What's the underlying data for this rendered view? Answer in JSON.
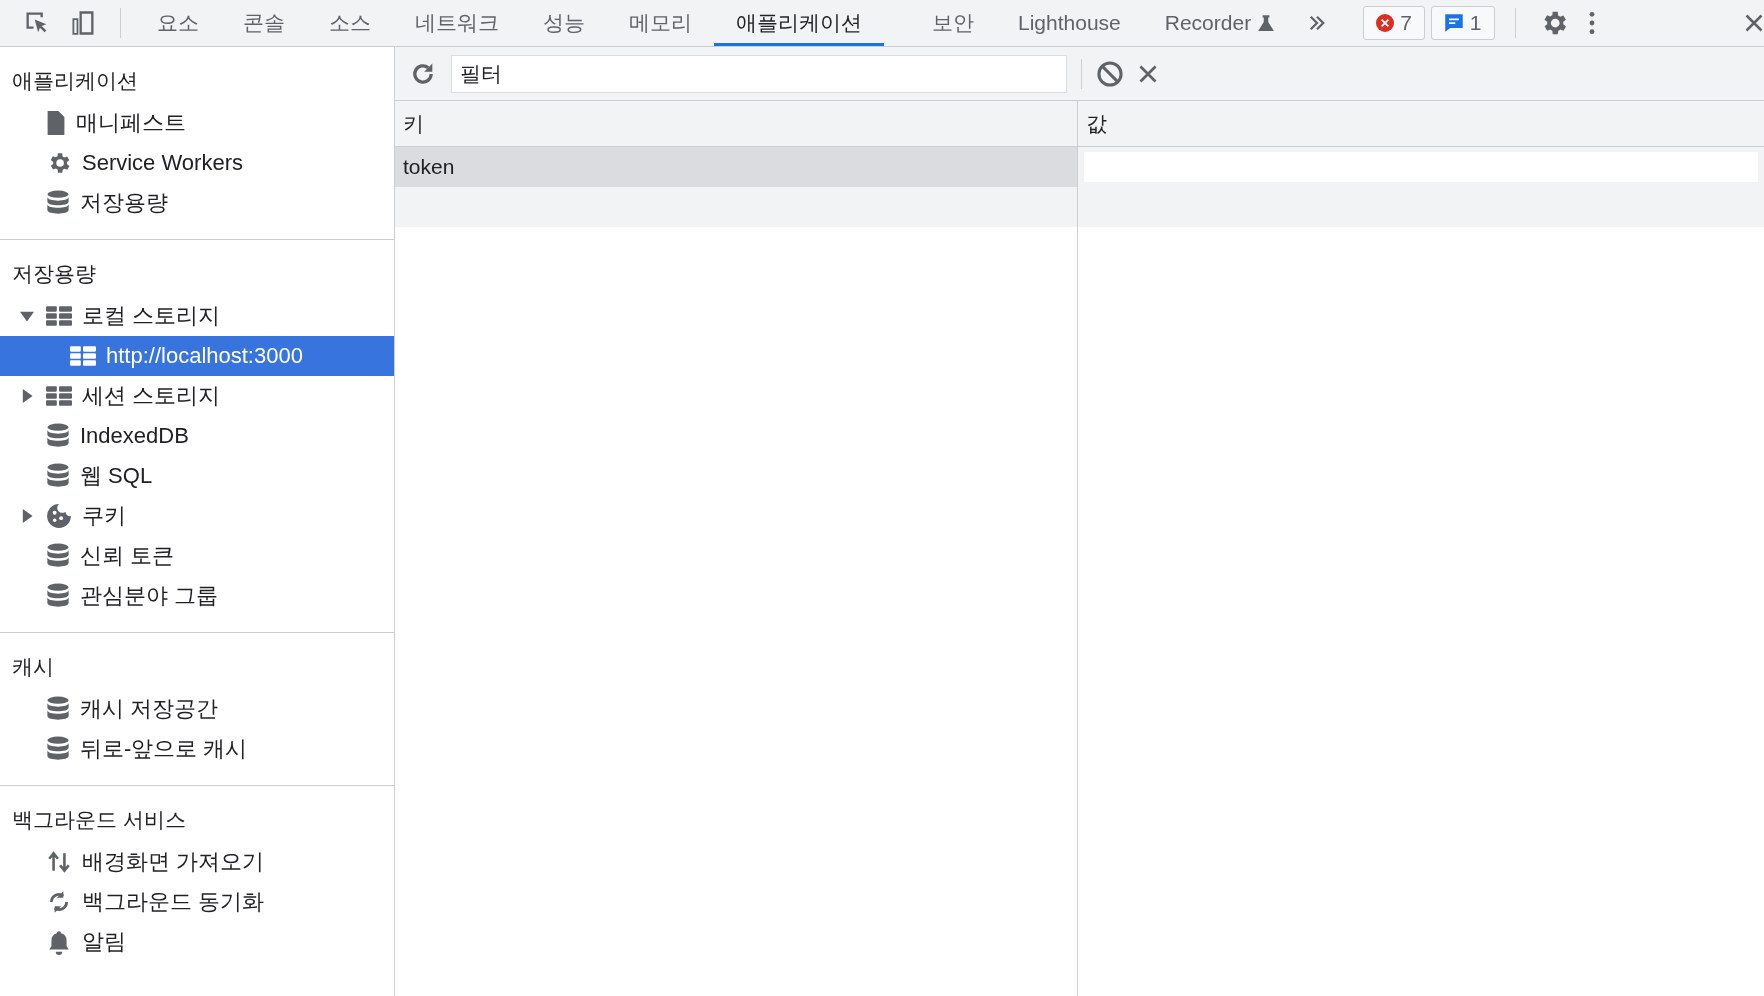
{
  "tabs": [
    {
      "label": "요소",
      "selected": false
    },
    {
      "label": "콘솔",
      "selected": false
    },
    {
      "label": "소스",
      "selected": false
    },
    {
      "label": "네트워크",
      "selected": false
    },
    {
      "label": "성능",
      "selected": false
    },
    {
      "label": "메모리",
      "selected": false
    },
    {
      "label": "애플리케이션",
      "selected": true
    },
    {
      "label": "보안",
      "selected": false
    },
    {
      "label": "Lighthouse",
      "selected": false
    },
    {
      "label": "Recorder",
      "selected": false,
      "kind": "experiment"
    }
  ],
  "badges": [
    {
      "kind": "error",
      "count": "7"
    },
    {
      "kind": "message",
      "count": "1"
    }
  ],
  "sidebar": [
    {
      "title": "애플리케이션",
      "items": [
        {
          "label": "매니페스트",
          "kind": "file",
          "selected": false
        },
        {
          "label": "Service Workers",
          "kind": "gear",
          "selected": false
        },
        {
          "label": "저장용량",
          "kind": "database",
          "selected": false
        }
      ]
    },
    {
      "title": "저장용량",
      "items": [
        {
          "label": "로컬 스토리지",
          "kind": "table",
          "selected": false,
          "expanded": true,
          "children": [
            {
              "label": "http://localhost:3000",
              "kind": "table",
              "selected": true
            }
          ]
        },
        {
          "label": "세션 스토리지",
          "kind": "table",
          "selected": false,
          "expanded": false
        },
        {
          "label": "IndexedDB",
          "kind": "database",
          "selected": false
        },
        {
          "label": "웹 SQL",
          "kind": "database",
          "selected": false
        },
        {
          "label": "쿠키",
          "kind": "cookie",
          "selected": false,
          "expanded": false
        },
        {
          "label": "신뢰 토큰",
          "kind": "database",
          "selected": false
        },
        {
          "label": "관심분야 그룹",
          "kind": "database",
          "selected": false
        }
      ]
    },
    {
      "title": "캐시",
      "items": [
        {
          "label": "캐시 저장공간",
          "kind": "database",
          "selected": false
        },
        {
          "label": "뒤로-앞으로 캐시",
          "kind": "database",
          "selected": false
        }
      ]
    },
    {
      "title": "백그라운드 서비스",
      "items": [
        {
          "label": "배경화면 가져오기",
          "kind": "updown",
          "selected": false
        },
        {
          "label": "백그라운드 동기화",
          "kind": "sync",
          "selected": false
        },
        {
          "label": "알림",
          "kind": "bell",
          "selected": false
        }
      ]
    }
  ],
  "filter": {
    "placeholder": "필터"
  },
  "table": {
    "columns": [
      "키",
      "값"
    ],
    "rows": [
      {
        "key": "token",
        "selected": true
      }
    ]
  }
}
